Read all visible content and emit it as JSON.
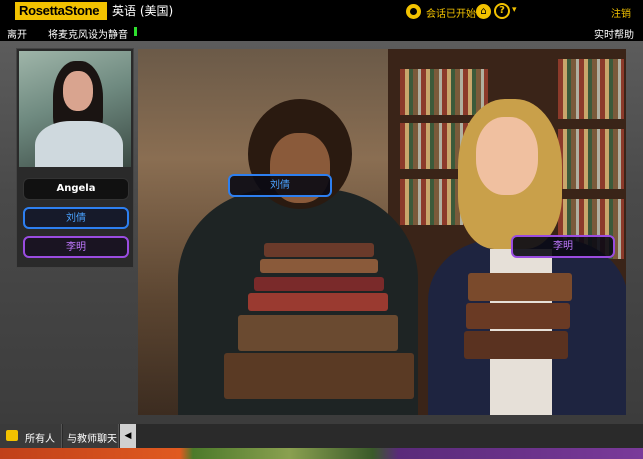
{
  "app": {
    "logo": "RosettaStone",
    "language": "英语 (美国)"
  },
  "topbar": {
    "session_status": "会话已开始",
    "logout_label": "注销"
  },
  "subbar": {
    "leave_label": "离开",
    "mute_label": "将麦克风设为静音",
    "realtime_help_label": "实时帮助"
  },
  "participants": [
    {
      "name": "Angela",
      "role": "tutor",
      "color": "#ffffff"
    },
    {
      "name": "刘倩",
      "color": "#2d7ff0"
    },
    {
      "name": "李明",
      "color": "#9a4ce0"
    }
  ],
  "scene_tags": [
    {
      "name": "刘倩",
      "color": "#2d7ff0"
    },
    {
      "name": "李明",
      "color": "#9a4ce0"
    }
  ],
  "chat_tabs": [
    {
      "label": "所有人"
    },
    {
      "label": "与教师聊天"
    }
  ],
  "colors": {
    "accent": "#f2c200",
    "blue": "#2d7ff0",
    "purple": "#9a4ce0",
    "mic_level": "#2ee02e"
  }
}
